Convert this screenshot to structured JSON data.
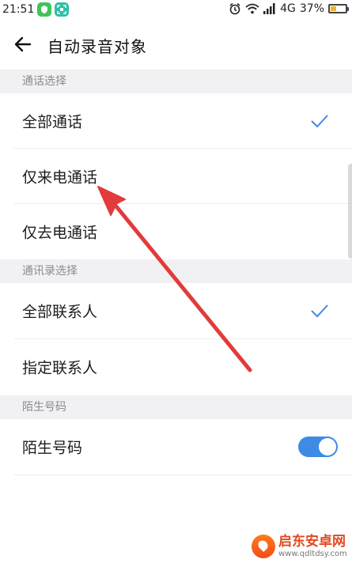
{
  "status_bar": {
    "time": "21:51",
    "network": "4G",
    "battery": "37%",
    "battery_level": 0.37
  },
  "header": {
    "title": "自动录音对象",
    "back_icon": "arrow-left-icon"
  },
  "sections": [
    {
      "header": "通话选择",
      "items": [
        {
          "label": "全部通话",
          "checked": true
        },
        {
          "label": "仅来电通话",
          "checked": false
        },
        {
          "label": "仅去电通话",
          "checked": false
        }
      ]
    },
    {
      "header": "通讯录选择",
      "items": [
        {
          "label": "全部联系人",
          "checked": true
        },
        {
          "label": "指定联系人",
          "checked": false
        }
      ]
    },
    {
      "header": "陌生号码",
      "items": [
        {
          "label": "陌生号码",
          "toggle": true
        }
      ]
    }
  ],
  "colors": {
    "accent": "#3e8be6",
    "annotation_arrow": "#e23b3b",
    "section_bg": "#f1f1f3"
  },
  "watermark": {
    "name": "启东安卓网",
    "url": "www.qdltdsy.com"
  }
}
